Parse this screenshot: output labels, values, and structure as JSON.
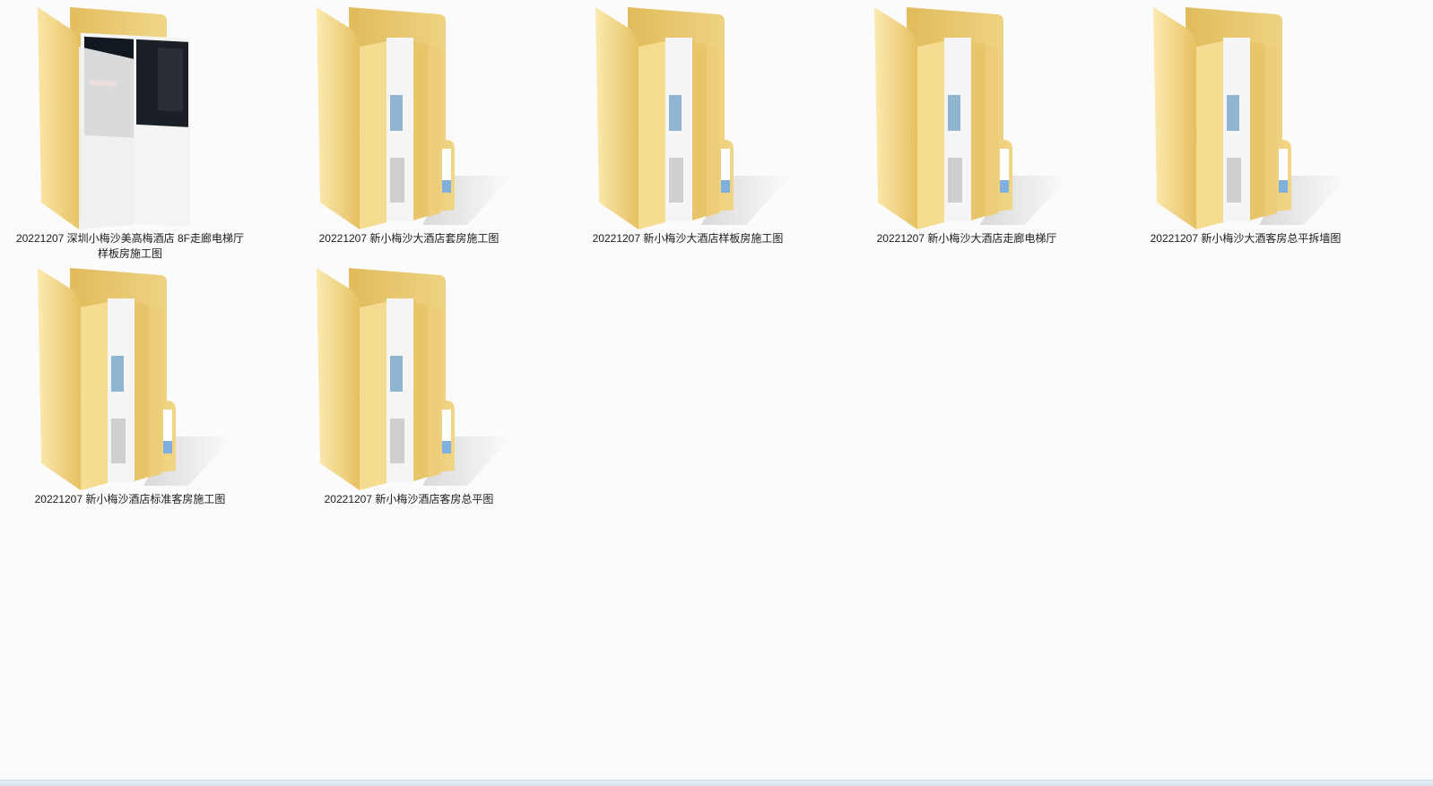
{
  "folders": [
    {
      "name": "20221207 深圳小梅沙美高梅酒店 8F走廊电梯厅样板房施工图",
      "name_line1": "20221207 深圳小梅沙美高梅酒店 8F走廊电梯厅",
      "name_line2": "样板房施工图",
      "icon": "folder-with-preview-icon"
    },
    {
      "name": "20221207 新小梅沙大酒店套房施工图",
      "name_line1": "20221207 新小梅沙大酒店套房施工图",
      "icon": "folder-icon"
    },
    {
      "name": "20221207 新小梅沙大酒店样板房施工图",
      "name_line1": "20221207 新小梅沙大酒店样板房施工图",
      "icon": "folder-icon"
    },
    {
      "name": "20221207 新小梅沙大酒店走廊电梯厅",
      "name_line1": "20221207 新小梅沙大酒店走廊电梯厅",
      "icon": "folder-icon"
    },
    {
      "name": "20221207 新小梅沙大酒客房总平拆墙图",
      "name_line1": "20221207 新小梅沙大酒客房总平拆墙图",
      "icon": "folder-icon"
    },
    {
      "name": "20221207 新小梅沙酒店标准客房施工图",
      "name_line1": "20221207 新小梅沙酒店标准客房施工图",
      "icon": "folder-icon"
    },
    {
      "name": "20221207 新小梅沙酒店客房总平图",
      "name_line1": "20221207 新小梅沙酒店客房总平图",
      "icon": "folder-icon"
    }
  ],
  "colors": {
    "background": "#fbfbfb",
    "folder_front": "#f3d27a",
    "folder_back": "#e9c665",
    "paper": "#f4f4f4"
  }
}
